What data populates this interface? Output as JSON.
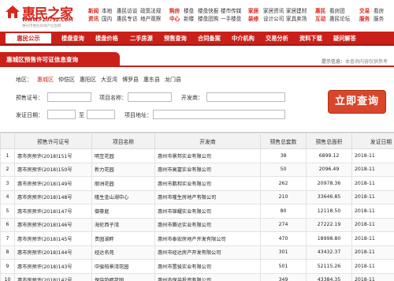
{
  "header": {
    "logo_text": "惠民之家",
    "logo_url": "WWW.FZ0752.COM",
    "logo_tagline": "惠州市惠民房地产信息网",
    "nav_columns": [
      {
        "head": "新闻",
        "sub": "资讯",
        "items": [
          "本地",
          "国内"
        ],
        "items2": [
          "惠民访谈",
          "惠民专访"
        ],
        "items3": [
          "政策法规",
          "地产观察"
        ]
      },
      {
        "head": "购房",
        "sub": "中心",
        "items": [
          "楼盘",
          "新楼"
        ],
        "items2": [
          "楼盘快报",
          "楼盘团购"
        ],
        "items3": [
          "楼市传媒",
          "一手楼盘"
        ]
      },
      {
        "head": "家居",
        "sub": "装修",
        "items": [
          "家居资讯",
          "设计公司"
        ],
        "items2": [
          "家居建材",
          "家具卖场"
        ]
      },
      {
        "head": "惠民",
        "sub": "互动",
        "items": [
          "看房团",
          "惠民论坛"
        ]
      },
      {
        "head": "交易",
        "sub": "服务",
        "items": [
          "看房",
          "服务"
        ]
      }
    ]
  },
  "mainnav": {
    "home_label": "惠民公示",
    "items": [
      "楼盘查询",
      "楼盘价格",
      "二手房源",
      "预售查询",
      "合同备案",
      "中介机构",
      "交易分析",
      "资料下载",
      "疑问解答"
    ]
  },
  "title": {
    "label": "惠城区预售许可证信息查询",
    "tip_label": "提示信息：",
    "tip_value": "本查询内容仅供参考"
  },
  "form": {
    "area_label": "地区：",
    "areas": [
      "惠城区",
      "仲恺区",
      "惠阳区",
      "大亚湾",
      "博罗县",
      "惠东县",
      "龙门县"
    ],
    "presale_no_label": "预售证号：",
    "project_label": "项目名称：",
    "developer_label": "开发商：",
    "date_label": "发证日期：",
    "date_to": "至",
    "address_label": "项目地址：",
    "search_label": "立即查询"
  },
  "table": {
    "headers": [
      "",
      "预售许可证号",
      "项目名称",
      "开发商",
      "预售总套数",
      "预售总面积",
      "发证日期"
    ],
    "rows": [
      [
        "1",
        "惠市房预许(2018)151号",
        "明至花园",
        "惠州市景邦实业有限公司",
        "38",
        "6899.12",
        "2018-11"
      ],
      [
        "2",
        "惠市房预许(2018)150号",
        "新力花园",
        "惠州市高富实业有限公司",
        "50",
        "2096.49",
        "2018-11"
      ],
      [
        "3",
        "惠市房预许(2018)149号",
        "丽洲花园",
        "惠州市鹏和实业有限公司",
        "262",
        "20978.36",
        "2018-11"
      ],
      [
        "4",
        "惠市房预许(2018)148号",
        "隆生金山湖中心",
        "惠州市隆生房地产有限公司",
        "210",
        "33646.85",
        "2018-11"
      ],
      [
        "5",
        "惠市房预许(2018)147号",
        "御豪庭",
        "惠州市锦耀实业有限公司",
        "80",
        "12118.50",
        "2018-11"
      ],
      [
        "6",
        "惠市房预许(2018)146号",
        "海伦西子湾",
        "惠州市腾达实业有限公司",
        "274",
        "27222.19",
        "2018-11"
      ],
      [
        "7",
        "惠市房预许(2018)145号",
        "贵园湖畔",
        "惠州市泰宏房地产开发有限公司",
        "470",
        "18998.80",
        "2018-11"
      ],
      [
        "8",
        "惠市房预许(2018)144号",
        "经达名苑",
        "惠州市经达房产开发有限公司",
        "301",
        "43432.37",
        "2018-11"
      ],
      [
        "9",
        "惠市房预许(2018)143号",
        "中骏柏景湾花园",
        "惠州市置骏实业有限公司",
        "501",
        "52115.26",
        "2018-11"
      ],
      [
        "10",
        "惠市房预许(2018)142号",
        "保华铂郡花园",
        "惠州市保华投资有限公司",
        "349",
        "43384.35",
        "2018-11"
      ]
    ]
  }
}
